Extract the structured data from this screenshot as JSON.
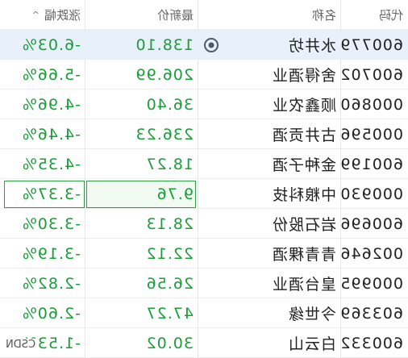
{
  "headers": {
    "code": "代码",
    "name": "名称",
    "price": "最新价",
    "change": "涨跌幅",
    "sort_indicator": "^"
  },
  "colors": {
    "down": "#1b9e3a",
    "selected_row": "#e8f1fb",
    "highlight_border": "#2f9e44"
  },
  "rows": [
    {
      "code": "600779",
      "name": "水井坊",
      "price": "138.10",
      "change": "-6.03%",
      "icon": "eye-icon",
      "selected": true
    },
    {
      "code": "600702",
      "name": "舍得酒业",
      "price": "206.99",
      "change": "-5.66%"
    },
    {
      "code": "000860",
      "name": "顺鑫农业",
      "price": "36.40",
      "change": "-4.96%"
    },
    {
      "code": "000596",
      "name": "古井贡酒",
      "price": "236.23",
      "change": "-4.46%"
    },
    {
      "code": "600199",
      "name": "金种子酒",
      "price": "18.27",
      "change": "-4.35%"
    },
    {
      "code": "000930",
      "name": "中粮科技",
      "price": "9.76",
      "change": "-3.37%",
      "highlighted": true
    },
    {
      "code": "600696",
      "name": "岩石股份",
      "price": "28.13",
      "change": "-3.30%"
    },
    {
      "code": "002646",
      "name": "青青稞酒",
      "price": "22.12",
      "change": "-3.19%"
    },
    {
      "code": "000995",
      "name": "皇台酒业",
      "price": "26.56",
      "change": "-2.82%"
    },
    {
      "code": "603369",
      "name": "今世缘",
      "price": "47.27",
      "change": "-2.60%"
    },
    {
      "code": "600332",
      "name": "白云山",
      "price": "30.02",
      "change": "-1.53%"
    }
  ],
  "corner_label": "CSDN"
}
